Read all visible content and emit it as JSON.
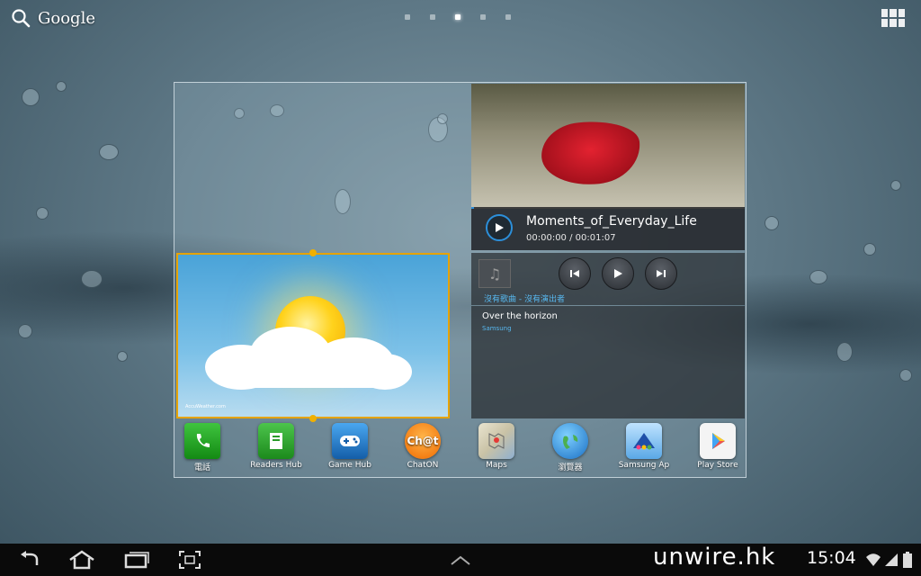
{
  "search": {
    "label": "Google"
  },
  "home": {
    "pages": 5,
    "active_page": 3
  },
  "video": {
    "title": "Moments_of_Everyday_Life",
    "time": "00:00:00 / 00:01:07"
  },
  "music": {
    "status": "沒有歌曲 - 沒有演出者"
  },
  "playlist": {
    "title": "Over the horizon",
    "artist": "Samsung"
  },
  "weather": {
    "brand": "AccuWeather.com"
  },
  "dock": [
    {
      "label": "電話"
    },
    {
      "label": "Readers Hub"
    },
    {
      "label": "Game Hub"
    },
    {
      "label": "ChatON"
    },
    {
      "label": "Maps"
    },
    {
      "label": "瀏覽器"
    },
    {
      "label": "Samsung Ap"
    },
    {
      "label": "Play Store"
    }
  ],
  "chaton_icon_text": "Ch@t",
  "status": {
    "watermark": "unwire.hk",
    "time": "15:04"
  },
  "colors": {
    "accent_blue": "#2c8fda",
    "selection_orange": "#e6a300",
    "navbar": "#0a0a0a"
  }
}
